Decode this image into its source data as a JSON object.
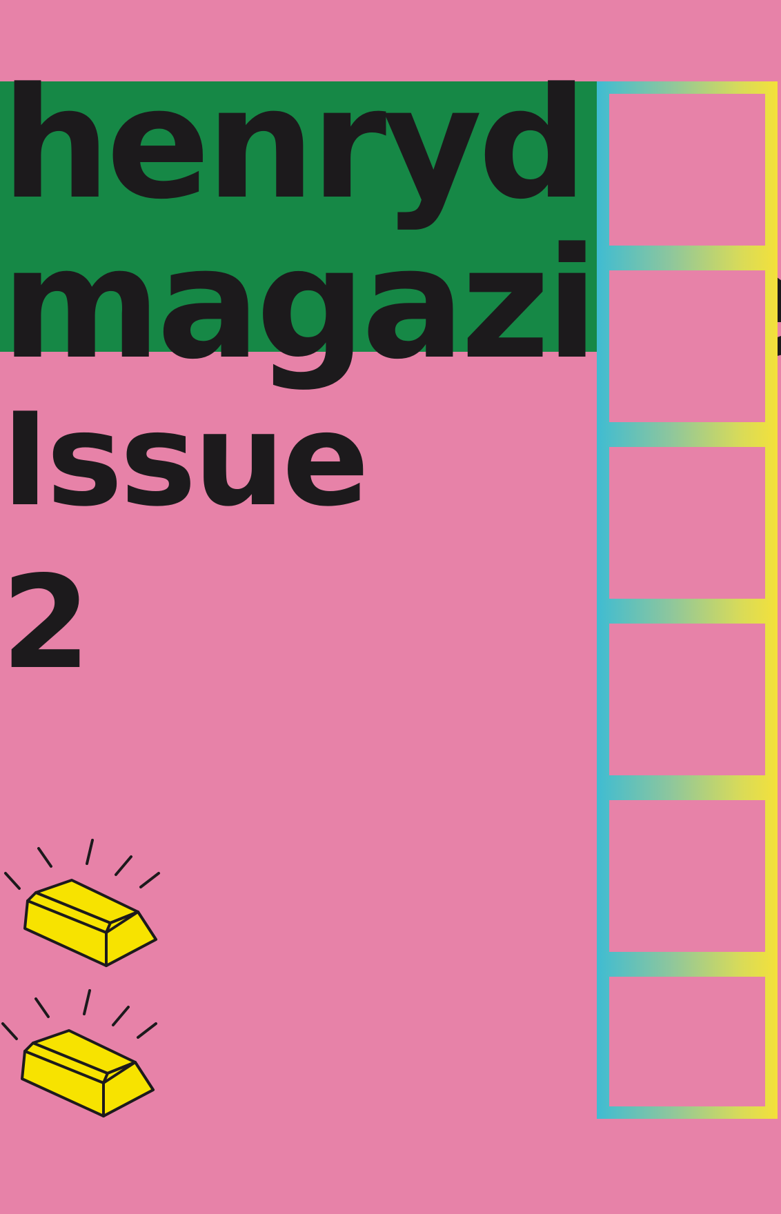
{
  "cover": {
    "title_line1": "henryd",
    "title_line2": "magazine",
    "issue_line1": "Issue",
    "issue_line2": "2"
  },
  "colors": {
    "background": "#e782a8",
    "title_block": "#168846",
    "text": "#1c1a1c",
    "frame_gradient_start": "#3fbcd2",
    "frame_gradient_end": "#f4e13a",
    "gold_bar": "#f7e300"
  },
  "icons": [
    "gold-bar-icon",
    "gold-bar-icon"
  ]
}
